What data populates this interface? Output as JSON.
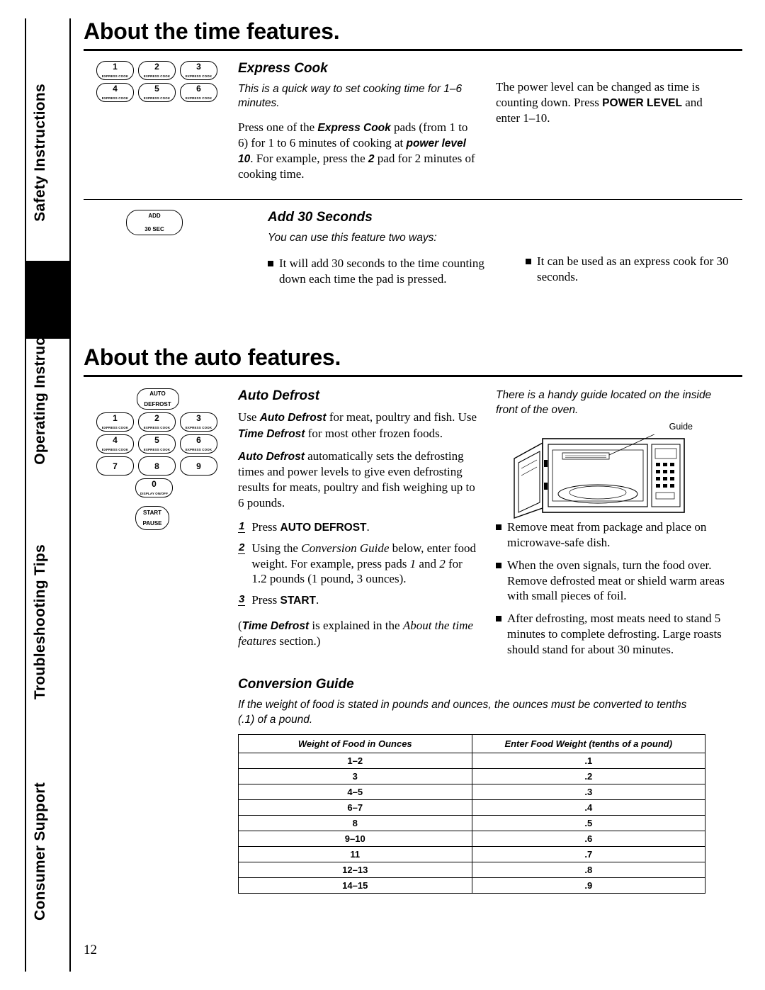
{
  "sidebar": {
    "tabs": [
      {
        "label": "Safety Instructions"
      },
      {
        "label": "Operating Instructions"
      },
      {
        "label": "Troubleshooting Tips"
      },
      {
        "label": "Consumer Support"
      }
    ]
  },
  "page_number": "12",
  "sections": [
    {
      "title": "About the time features.",
      "subsections": [
        {
          "heading": "Express Cook",
          "intro": "This is a quick way to set cooking time for 1–6 minutes.",
          "body_left": "Press one of the Express Cook pads (from 1 to 6) for 1 to 6 minutes of cooking at power level 10. For example, press the 2 pad for 2 minutes of cooking time.",
          "body_right": "The power level can be changed as time is counting down. Press POWER LEVEL and enter 1–10.",
          "keypad": [
            {
              "num": "1",
              "label": "EXPRESS COOK"
            },
            {
              "num": "2",
              "label": "EXPRESS COOK"
            },
            {
              "num": "3",
              "label": "EXPRESS COOK"
            },
            {
              "num": "4",
              "label": "EXPRESS COOK"
            },
            {
              "num": "5",
              "label": "EXPRESS COOK"
            },
            {
              "num": "6",
              "label": "EXPRESS COOK"
            }
          ]
        },
        {
          "heading": "Add 30 Seconds",
          "pad_line1": "ADD",
          "pad_line2": "30 SEC",
          "intro": "You can use this feature two ways:",
          "bullets": [
            "It will add 30 seconds to the time counting down each time the pad is pressed.",
            "It can be used as an express cook for 30 seconds."
          ]
        }
      ]
    },
    {
      "title": "About the auto features.",
      "subsections": [
        {
          "heading": "Auto Defrost",
          "pad_auto_l1": "AUTO",
          "pad_auto_l2": "DEFROST",
          "pad_display_l1": "0",
          "pad_display_l2": "DISPLAY ON/OFF",
          "pad_start_l1": "START",
          "pad_start_l2": "PAUSE",
          "keypad": [
            {
              "num": "1",
              "label": "EXPRESS COOK"
            },
            {
              "num": "2",
              "label": "EXPRESS COOK"
            },
            {
              "num": "3",
              "label": "EXPRESS COOK"
            },
            {
              "num": "4",
              "label": "EXPRESS COOK"
            },
            {
              "num": "5",
              "label": "EXPRESS COOK"
            },
            {
              "num": "6",
              "label": "EXPRESS COOK"
            },
            {
              "num": "7",
              "label": ""
            },
            {
              "num": "8",
              "label": ""
            },
            {
              "num": "9",
              "label": ""
            }
          ],
          "para1": "Use Auto Defrost for meat, poultry and fish. Use Time Defrost for most other frozen foods.",
          "para2": "Auto Defrost automatically sets the defrosting times and power levels to give even defrosting results for meats, poultry and fish weighing up to 6 pounds.",
          "steps": [
            {
              "n": "1",
              "text": "Press AUTO DEFROST."
            },
            {
              "n": "2",
              "text": "Using the Conversion Guide below, enter food weight. For example, press pads 1 and 2 for 1.2 pounds (1 pound, 3 ounces)."
            },
            {
              "n": "3",
              "text": "Press START."
            }
          ],
          "note": "(Time Defrost is explained in the About the time features section.)",
          "right_intro": "There is a handy guide located on the inside front of the oven.",
          "guide_caption": "Guide",
          "right_bullets": [
            "Remove meat from package and place on microwave-safe dish.",
            "When the oven signals, turn the food over. Remove defrosted meat or shield warm areas with small pieces of foil.",
            "After defrosting, most meats need to stand 5 minutes to complete defrosting. Large roasts should stand for about 30 minutes."
          ]
        },
        {
          "heading": "Conversion Guide",
          "intro": "If the weight of food is stated in pounds and ounces, the ounces must be converted to tenths (.1) of a pound.",
          "table": {
            "headers": [
              "Weight of Food in Ounces",
              "Enter Food Weight (tenths of a pound)"
            ],
            "rows": [
              [
                "1–2",
                ".1"
              ],
              [
                "3",
                ".2"
              ],
              [
                "4–5",
                ".3"
              ],
              [
                "6–7",
                ".4"
              ],
              [
                "8",
                ".5"
              ],
              [
                "9–10",
                ".6"
              ],
              [
                "11",
                ".7"
              ],
              [
                "12–13",
                ".8"
              ],
              [
                "14–15",
                ".9"
              ]
            ]
          }
        }
      ]
    }
  ]
}
